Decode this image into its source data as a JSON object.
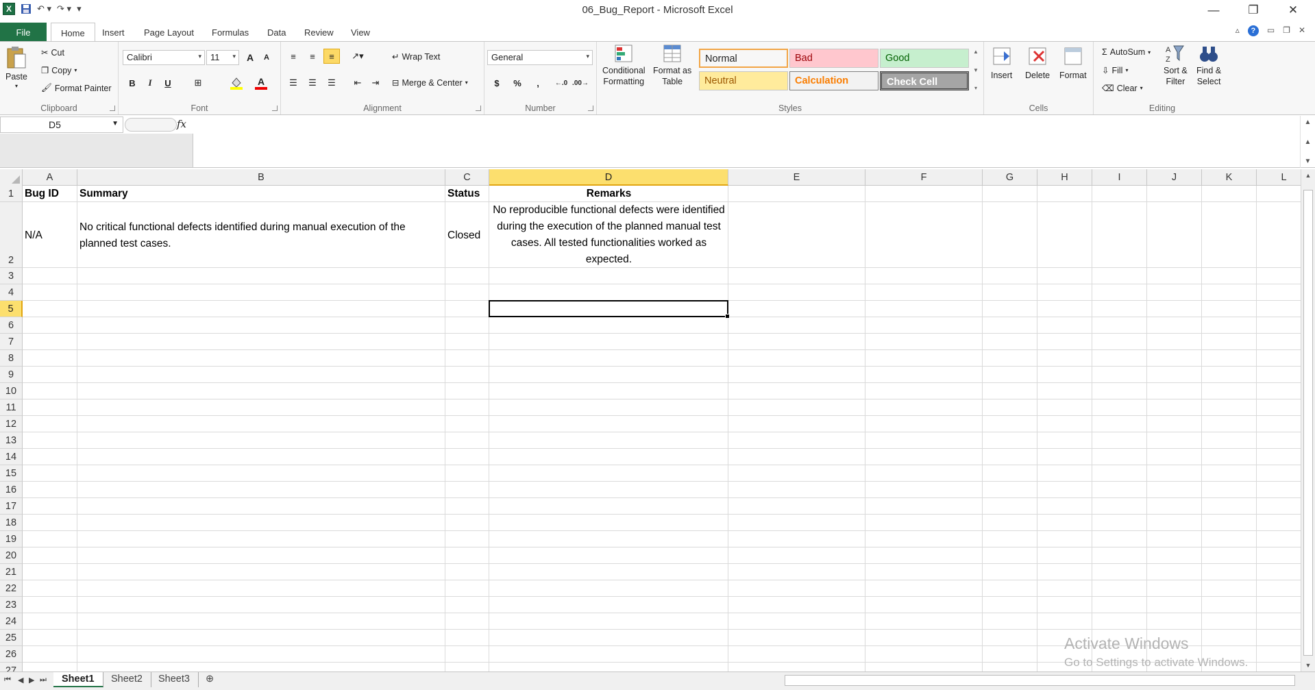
{
  "window": {
    "title": "06_Bug_Report - Microsoft Excel",
    "minimize_glyph": "—",
    "restore_glyph": "❐",
    "close_glyph": "✕"
  },
  "quick_access": {
    "logo": "X"
  },
  "ribbon_tabs": [
    "File",
    "Home",
    "Insert",
    "Page Layout",
    "Formulas",
    "Data",
    "Review",
    "View"
  ],
  "clipboard": {
    "paste": "Paste",
    "cut": "Cut",
    "copy": "Copy",
    "format_painter": "Format Painter",
    "label": "Clipboard"
  },
  "font": {
    "name": "Calibri",
    "size": "11",
    "grow": "A",
    "shrink": "A",
    "bold": "B",
    "italic": "I",
    "underline": "U",
    "label": "Font"
  },
  "alignment": {
    "wrap_text": "Wrap Text",
    "merge_center": "Merge & Center",
    "label": "Alignment"
  },
  "number": {
    "format": "General",
    "currency": "$",
    "percent": "%",
    "comma": ",",
    "label": "Number"
  },
  "styles": {
    "conditional": "Conditional\nFormatting",
    "format_table": "Format as\nTable",
    "cells": [
      {
        "label": "Normal",
        "bg": "#ffffff",
        "fg": "#000000"
      },
      {
        "label": "Bad",
        "bg": "#ffc7ce",
        "fg": "#9c0006"
      },
      {
        "label": "Good",
        "bg": "#c6efce",
        "fg": "#006100"
      },
      {
        "label": "Neutral",
        "bg": "#ffeb9c",
        "fg": "#9c5700"
      },
      {
        "label": "Calculation",
        "bg": "#f2f2f2",
        "fg": "#fa7d00"
      },
      {
        "label": "Check Cell",
        "bg": "#a5a5a5",
        "fg": "#ffffff"
      }
    ],
    "label": "Styles"
  },
  "cells_group": {
    "insert": "Insert",
    "delete": "Delete",
    "format": "Format",
    "label": "Cells"
  },
  "editing": {
    "autosum": "AutoSum",
    "fill": "Fill",
    "clear": "Clear",
    "sort_filter": "Sort &\nFilter",
    "find_select": "Find &\nSelect",
    "label": "Editing"
  },
  "formula_bar": {
    "name_box": "D5",
    "fx": "fx",
    "value": ""
  },
  "columns": [
    "A",
    "B",
    "C",
    "D",
    "E",
    "F",
    "G",
    "H",
    "I",
    "J",
    "K",
    "L"
  ],
  "selected_column": "D",
  "rows": [
    "1",
    "2",
    "3",
    "4",
    "5",
    "6",
    "7",
    "8",
    "9",
    "10",
    "11",
    "12",
    "13",
    "14",
    "15",
    "16",
    "17",
    "18",
    "19",
    "20",
    "21",
    "22",
    "23",
    "24",
    "25",
    "26",
    "27"
  ],
  "selected_row": "5",
  "sheet": {
    "header": {
      "A": "Bug ID",
      "B": "Summary",
      "C": "Status",
      "D": "Remarks"
    },
    "row2": {
      "A": "N/A",
      "B": "No critical functional defects identified during manual execution of the planned test cases.",
      "C": "Closed",
      "D": "No reproducible functional defects were identified during the execution of the planned manual test cases. All tested functionalities worked as expected."
    }
  },
  "sheet_tabs": [
    "Sheet1",
    "Sheet2",
    "Sheet3"
  ],
  "active_sheet": "Sheet1",
  "watermark": {
    "line1": "Activate Windows",
    "line2": "Go to Settings to activate Windows."
  },
  "colors": {
    "excel_green": "#217346",
    "selected_header": "#fcdf6e"
  }
}
